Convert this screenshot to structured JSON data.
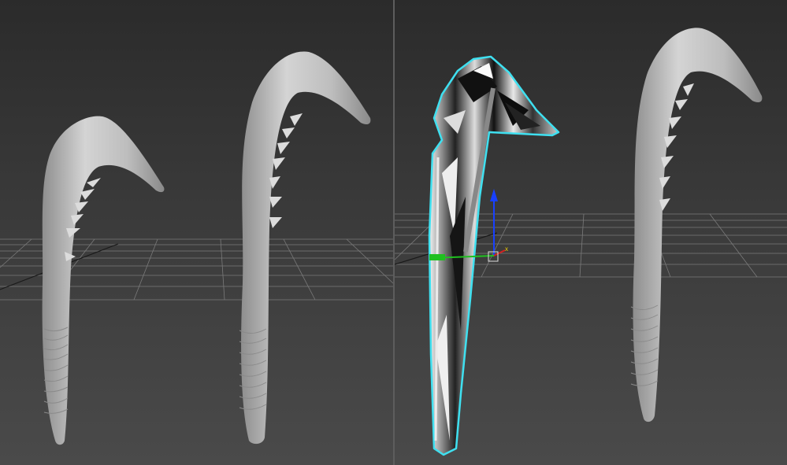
{
  "viewports": [
    {
      "id": "left",
      "objects": [
        "club-model-low",
        "club-model-high"
      ],
      "selected": false
    },
    {
      "id": "right",
      "objects": [
        "club-model-distorted",
        "club-model-reference"
      ],
      "selected": true
    }
  ],
  "colors": {
    "background_top": "#2b2b2b",
    "background_bottom": "#4a4a4a",
    "grid": "#8a8a8a",
    "mesh_light": "#c8c8c8",
    "selection_outline": "#3fe0f0",
    "gizmo_x": "#d22222",
    "gizmo_y": "#20c020",
    "gizmo_z": "#1840ff"
  },
  "gizmo": {
    "x_label": "x"
  }
}
